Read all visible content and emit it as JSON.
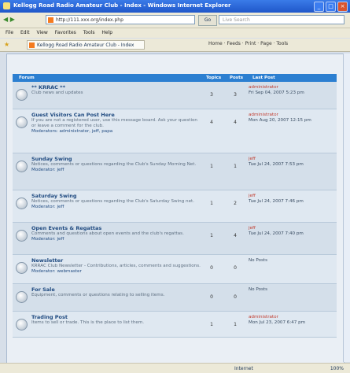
{
  "window": {
    "title": "Kellogg Road Radio Amateur Club - Index - Windows Internet Explorer",
    "min": "_",
    "max": "□",
    "close": "×"
  },
  "addressbar": {
    "url": "http://111.xxx.org/index.php",
    "go": "Go",
    "search_placeholder": "Live Search"
  },
  "menubar": [
    "File",
    "Edit",
    "View",
    "Favorites",
    "Tools",
    "Help"
  ],
  "favorites": {
    "tab": "Kellogg Road Radio Amateur Club - Index",
    "tools": "Home · Feeds · Print · Page · Tools"
  },
  "forum": {
    "columns": {
      "forum": "Forum",
      "topics": "Topics",
      "posts": "Posts",
      "last": "Last Post"
    },
    "rows": [
      {
        "title": "** KRRAC **",
        "desc": "Club news and updates",
        "mods": "",
        "topics": "3",
        "posts": "3",
        "last_by": "administrator",
        "last_time": "Fri Sep 04, 2007 5:23 pm"
      },
      {
        "title": "Guest Visitors Can Post Here",
        "desc": "If you are not a registered user, use this message board. Ask your question or leave a comment for the club.",
        "mods": "Moderators: administrator, jeff, papa",
        "topics": "4",
        "posts": "4",
        "last_by": "administrator",
        "last_time": "Mon Aug 20, 2007 12:15 pm"
      },
      {
        "title": "Sunday Swing",
        "desc": "Notices, comments or questions regarding the Club's Sunday Morning Net.",
        "mods": "Moderator: jeff",
        "topics": "1",
        "posts": "1",
        "last_by": "jeff",
        "last_time": "Tue Jul 24, 2007 7:53 pm"
      },
      {
        "title": "Saturday Swing",
        "desc": "Notices, comments or questions regarding the Club's Saturday Swing net.",
        "mods": "Moderator: jeff",
        "topics": "1",
        "posts": "2",
        "last_by": "jeff",
        "last_time": "Tue Jul 24, 2007 7:46 pm"
      },
      {
        "title": "Open Events & Regattas",
        "desc": "Comments and questions about open events and the club's regattas.",
        "mods": "Moderator: jeff",
        "topics": "1",
        "posts": "4",
        "last_by": "jeff",
        "last_time": "Tue Jul 24, 2007 7:40 pm"
      },
      {
        "title": "Newsletter",
        "desc": "KRRAC Club Newsletter - Contributions, articles, comments and suggestions.",
        "mods": "Moderator: webmaster",
        "topics": "0",
        "posts": "0",
        "last_by": "",
        "last_time": "No Posts"
      },
      {
        "title": "For Sale",
        "desc": "Equipment, comments or questions relating to selling items.",
        "mods": "",
        "topics": "0",
        "posts": "0",
        "last_by": "",
        "last_time": "No Posts"
      },
      {
        "title": "Trading Post",
        "desc": "Items to sell or trade. This is the place to list them.",
        "mods": "",
        "topics": "1",
        "posts": "1",
        "last_by": "administrator",
        "last_time": "Mon Jul 23, 2007 6:47 pm"
      }
    ]
  },
  "status": {
    "zone": "Internet",
    "zoom": "100%"
  }
}
